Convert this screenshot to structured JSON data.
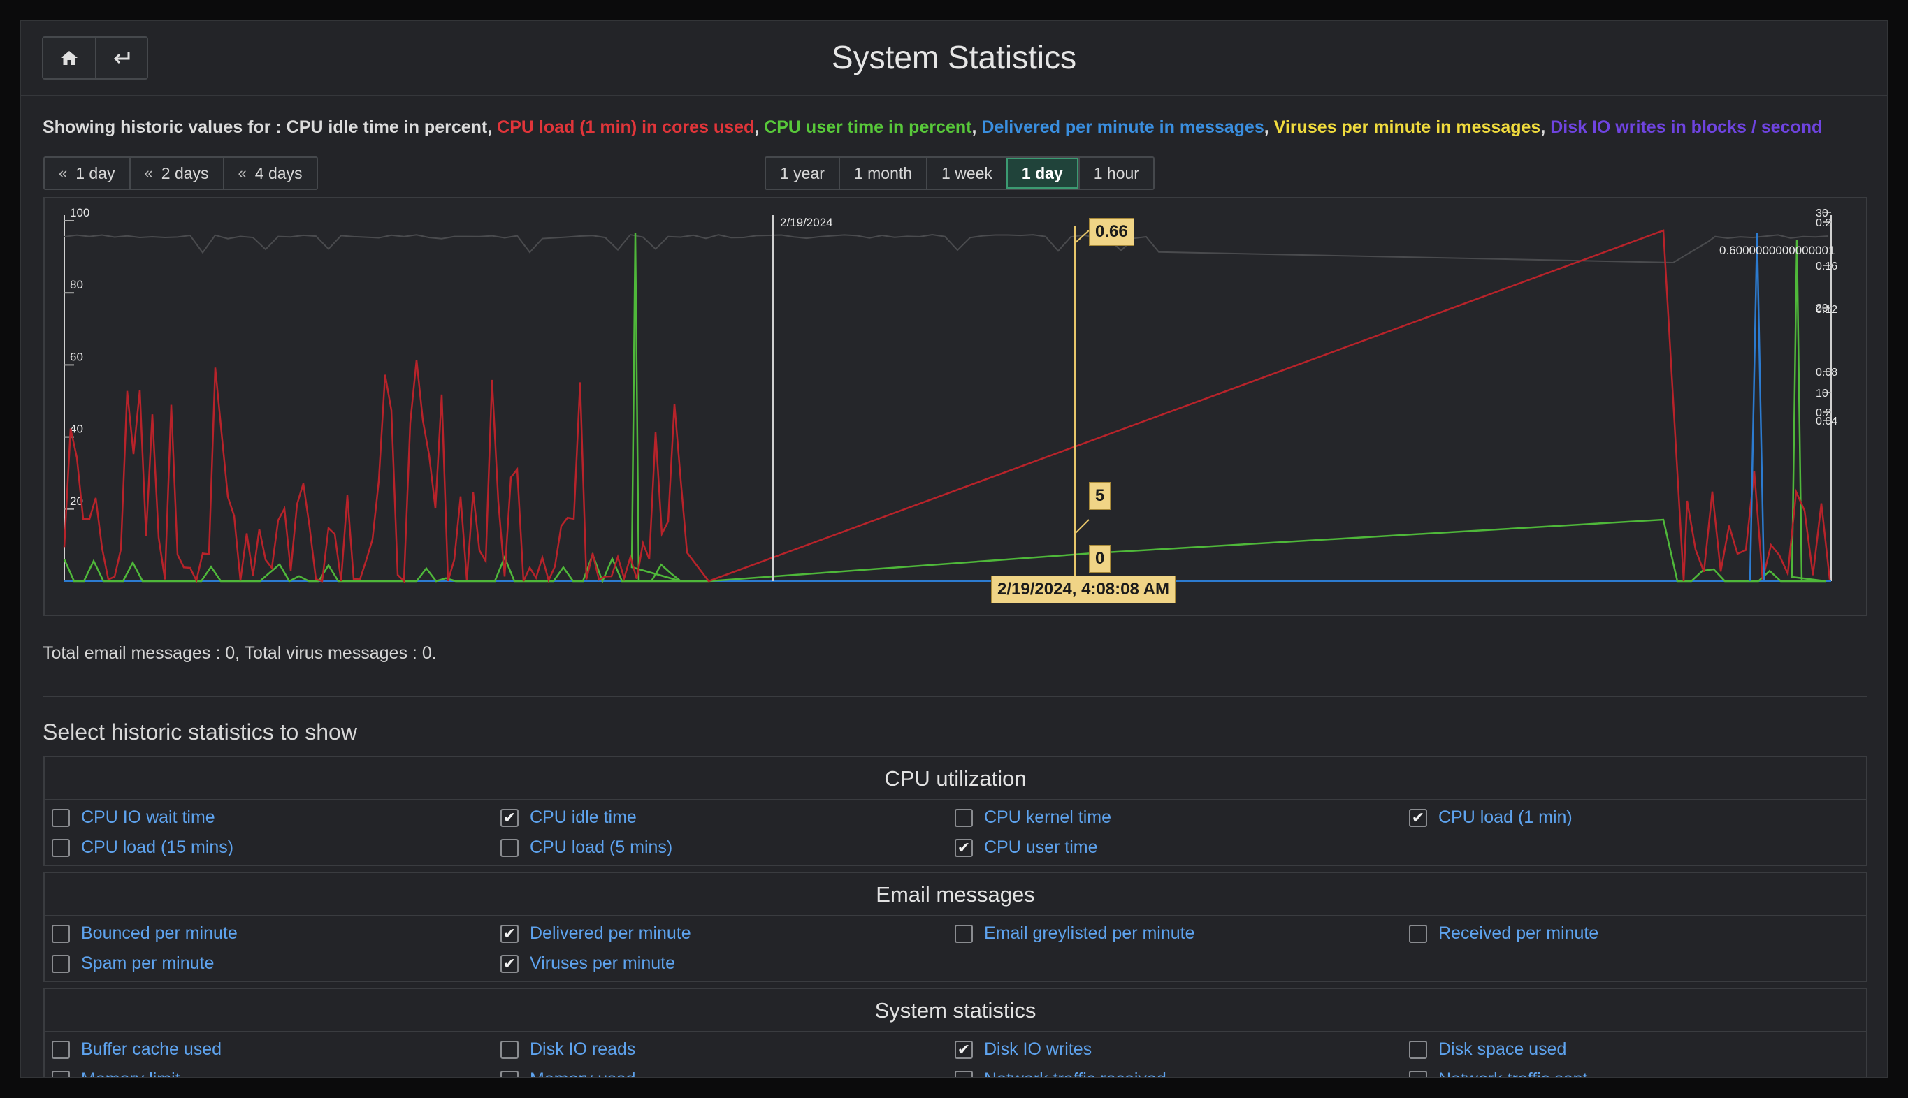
{
  "title": "System Statistics",
  "nav": {
    "home_icon": "home-icon",
    "back_icon": "back-arrow-icon"
  },
  "showing": {
    "prefix": "Showing historic values for : ",
    "series": [
      {
        "text": "CPU idle time in percent",
        "color": "#dcdcdc"
      },
      {
        "text": "CPU load (1 min) in cores used",
        "color": "#e0353a"
      },
      {
        "text": "CPU user time in percent",
        "color": "#58c83a"
      },
      {
        "text": "Delivered per minute in messages",
        "color": "#3a8fe0"
      },
      {
        "text": "Viruses per minute in messages",
        "color": "#f1dc3e"
      },
      {
        "text": "Disk IO writes in blocks / second",
        "color": "#6f44e0"
      }
    ],
    "sep": ", "
  },
  "back_buttons": [
    "1 day",
    "2 days",
    "4 days"
  ],
  "range_buttons": [
    "1 year",
    "1 month",
    "1 week",
    "1 day",
    "1 hour"
  ],
  "active_range": "1 day",
  "tooltips": {
    "value1": "0.66",
    "value2": "5",
    "value3": "0",
    "date": "2/19/2024, 4:08:08 AM"
  },
  "chart_data": {
    "type": "line",
    "left_axis_ticks": [
      "100",
      "80",
      "60",
      "40",
      "20"
    ],
    "right_axis_ticks": [
      "30",
      "0.2",
      "0.16",
      "20",
      "0.12",
      "0.08",
      "10",
      "0.2",
      "0.04"
    ],
    "date_marker": "2/19/2024",
    "spike_label": "0.6000000000000001",
    "series": [
      {
        "name": "CPU idle time",
        "color": "#4a4b4e",
        "description": "near 99-100% throughout with small dips"
      },
      {
        "name": "CPU load (1 min)",
        "color": "#b8232a",
        "description": "noisy 0-0.2 early, linear gap rising to 0.2, then drop and small spikes"
      },
      {
        "name": "CPU user time",
        "color": "#4fb83a",
        "description": "near 0 with spikes near 100% around index ~40 and end"
      },
      {
        "name": "Delivered per minute",
        "color": "#2c7bd0",
        "description": "0 except one spike near end"
      }
    ]
  },
  "totals": "Total email messages : 0, Total virus messages : 0.",
  "select_title": "Select historic statistics to show",
  "sections": [
    {
      "title": "CPU utilization",
      "options": [
        {
          "label": "CPU IO wait time",
          "checked": false
        },
        {
          "label": "CPU idle time",
          "checked": true
        },
        {
          "label": "CPU kernel time",
          "checked": false
        },
        {
          "label": "CPU load (1 min)",
          "checked": true
        },
        {
          "label": "CPU load (15 mins)",
          "checked": false
        },
        {
          "label": "CPU load (5 mins)",
          "checked": false
        },
        {
          "label": "CPU user time",
          "checked": true
        }
      ]
    },
    {
      "title": "Email messages",
      "options": [
        {
          "label": "Bounced per minute",
          "checked": false
        },
        {
          "label": "Delivered per minute",
          "checked": true
        },
        {
          "label": "Email greylisted per minute",
          "checked": false
        },
        {
          "label": "Received per minute",
          "checked": false
        },
        {
          "label": "Spam per minute",
          "checked": false
        },
        {
          "label": "Viruses per minute",
          "checked": true
        }
      ]
    },
    {
      "title": "System statistics",
      "options": [
        {
          "label": "Buffer cache used",
          "checked": false
        },
        {
          "label": "Disk IO reads",
          "checked": false
        },
        {
          "label": "Disk IO writes",
          "checked": true
        },
        {
          "label": "Disk space used",
          "checked": false
        },
        {
          "label": "Memory limit",
          "checked": false
        },
        {
          "label": "Memory used",
          "checked": false
        },
        {
          "label": "Network traffic received",
          "checked": false
        },
        {
          "label": "Network traffic sent",
          "checked": false
        }
      ]
    }
  ]
}
